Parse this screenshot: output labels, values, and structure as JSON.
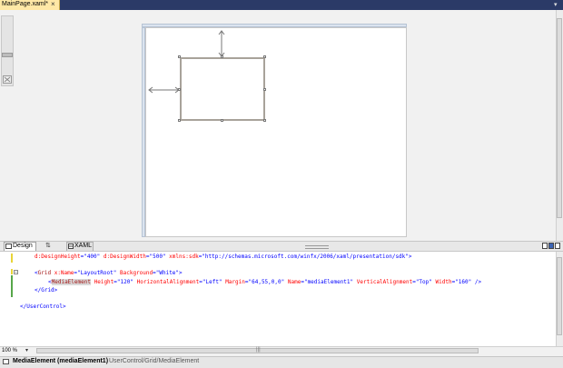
{
  "document_tab": {
    "title": "MainPage.xaml*",
    "close": "×"
  },
  "tab_overflow": "▾",
  "zoom_fit_icon": "fit-to-screen-icon",
  "view_tabs": {
    "design": "Design",
    "swap": "⇅",
    "xaml": "XAML"
  },
  "code_lines": {
    "l1": {
      "a1": "d:DesignHeight",
      "eq1": "=",
      "v1": "\"400\"",
      "a2": "d:DesignWidth",
      "eq2": "=",
      "v2": "\"500\"",
      "a3": "xmlns:sdk",
      "eq3": "=",
      "v3": "\"http://schemas.microsoft.com/winfx/2006/xaml/presentation/sdk\"",
      "end": ">"
    },
    "l2": {
      "open": "<",
      "el": "Grid",
      "a1": "x:Name",
      "eq1": "=",
      "v1": "\"LayoutRoot\"",
      "a2": "Background",
      "eq2": "=",
      "v2": "\"White\"",
      "end": ">"
    },
    "l3": {
      "open": "<",
      "el": "MediaElement",
      "a1": "Height",
      "eq1": "=",
      "v1": "\"120\"",
      "a2": "HorizontalAlignment",
      "eq2": "=",
      "v2": "\"Left\"",
      "a3": "Margin",
      "eq3": "=",
      "v3": "\"64,55,0,0\"",
      "a4": "Name",
      "eq4": "=",
      "v4": "\"mediaElement1\"",
      "a5": "VerticalAlignment",
      "eq5": "=",
      "v5": "\"Top\"",
      "a6": "Width",
      "eq6": "=",
      "v6": "\"160\"",
      "end": "/>"
    },
    "l4": {
      "text": "</Grid>"
    },
    "l5": {
      "text": "</UserControl>"
    }
  },
  "zoom": {
    "value": "100 %",
    "dropdown": "▾"
  },
  "hscroll_grip": "|||",
  "breadcrumb": {
    "element": "MediaElement (mediaElement1)",
    "path": "UserControl/Grid/MediaElement"
  },
  "colors": {
    "tab_strip": "#2b3a67",
    "active_tab": "#ffe8a6",
    "xaml_element": "#a31515",
    "xaml_attribute": "#ff0000",
    "xaml_value": "#0000ff"
  }
}
